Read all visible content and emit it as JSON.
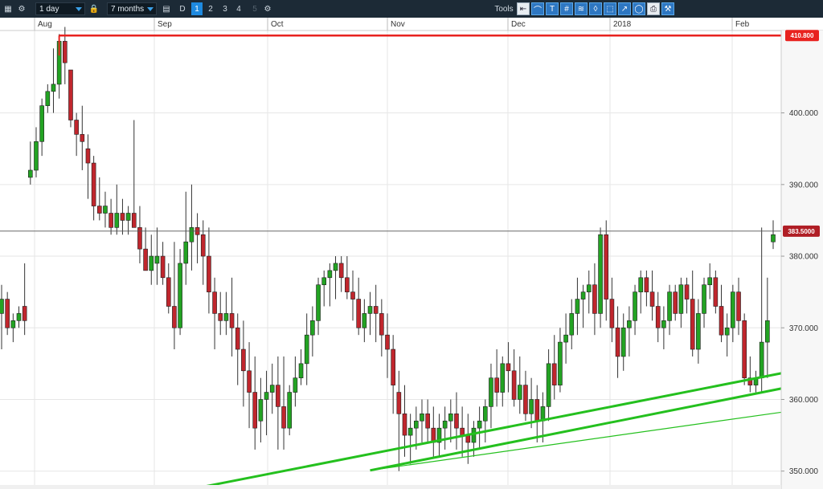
{
  "toolbar": {
    "interval": "1 day",
    "range": "7 months",
    "d_label": "D",
    "layouts": [
      "1",
      "2",
      "3",
      "4",
      "5"
    ],
    "tools_label": "Tools"
  },
  "colors": {
    "up": "#23a323",
    "down": "#c0262d",
    "resistance": "#e8221f",
    "support": "#24c01e",
    "grid": "#e6e6e6"
  },
  "chart_data": {
    "type": "candlestick",
    "y_axis": {
      "ticks": [
        "350.000",
        "360.000",
        "370.000",
        "380.000",
        "390.000",
        "400.000"
      ],
      "ylim": [
        347.5,
        411.5
      ],
      "grid": true
    },
    "x_axis": {
      "months": [
        "Aug",
        "Sep",
        "Oct",
        "Nov",
        "Dec",
        "2018",
        "Feb"
      ]
    },
    "last_price": "383.5000",
    "resistance_level": "410.800",
    "candles": [
      [
        372,
        376,
        367,
        374
      ],
      [
        374,
        375,
        369,
        370
      ],
      [
        370,
        372,
        368,
        371
      ],
      [
        371,
        373,
        370,
        372
      ],
      [
        373,
        379,
        369,
        371
      ],
      [
        391,
        396,
        390,
        392
      ],
      [
        392,
        398,
        391,
        396
      ],
      [
        396,
        402,
        394,
        401
      ],
      [
        401,
        404,
        400,
        403
      ],
      [
        403,
        409,
        400,
        404
      ],
      [
        404,
        411,
        402,
        410
      ],
      [
        410,
        412,
        404,
        407
      ],
      [
        406,
        406,
        398,
        399
      ],
      [
        399,
        400,
        394,
        397
      ],
      [
        397,
        401,
        392,
        396
      ],
      [
        395,
        397,
        388,
        393
      ],
      [
        393,
        394,
        385,
        387
      ],
      [
        387,
        391,
        385,
        386
      ],
      [
        386,
        389,
        384,
        387
      ],
      [
        386,
        388,
        383,
        384
      ],
      [
        384,
        390,
        383,
        386
      ],
      [
        386,
        388,
        383,
        385
      ],
      [
        385,
        387,
        383,
        386
      ],
      [
        386,
        399,
        385,
        384
      ],
      [
        384,
        387,
        379,
        381
      ],
      [
        381,
        384,
        378,
        378
      ],
      [
        378,
        383,
        376,
        380
      ],
      [
        379,
        384,
        376,
        380
      ],
      [
        380,
        382,
        376,
        377
      ],
      [
        377,
        379,
        372,
        373
      ],
      [
        373,
        382,
        367,
        370
      ],
      [
        370,
        381,
        369,
        379
      ],
      [
        379,
        389,
        376,
        382
      ],
      [
        382,
        390,
        378,
        384
      ],
      [
        384,
        386,
        379,
        383
      ],
      [
        383,
        385,
        376,
        380
      ],
      [
        380,
        384,
        372,
        375
      ],
      [
        375,
        377,
        367,
        372
      ],
      [
        372,
        375,
        369,
        371
      ],
      [
        371,
        375,
        369,
        372
      ],
      [
        372,
        377,
        366,
        370
      ],
      [
        370,
        372,
        362,
        367
      ],
      [
        367,
        371,
        359,
        364
      ],
      [
        364,
        368,
        356,
        361
      ],
      [
        361,
        366,
        353,
        356
      ],
      [
        357,
        363,
        354,
        360
      ],
      [
        360,
        364,
        355,
        361
      ],
      [
        361,
        365,
        358,
        362
      ],
      [
        362,
        366,
        353,
        359
      ],
      [
        359,
        366,
        353,
        356
      ],
      [
        356,
        362,
        355,
        361
      ],
      [
        361,
        366,
        359,
        363
      ],
      [
        363,
        367,
        362,
        365
      ],
      [
        365,
        372,
        362,
        369
      ],
      [
        369,
        373,
        366,
        371
      ],
      [
        371,
        377,
        369,
        376
      ],
      [
        376,
        378,
        373,
        377
      ],
      [
        377,
        379,
        373,
        378
      ],
      [
        378,
        380,
        374,
        379
      ],
      [
        379,
        380,
        375,
        377
      ],
      [
        377,
        380,
        374,
        375
      ],
      [
        375,
        378,
        371,
        374
      ],
      [
        374,
        377,
        369,
        370
      ],
      [
        370,
        374,
        368,
        372
      ],
      [
        372,
        375,
        369,
        373
      ],
      [
        373,
        376,
        368,
        372
      ],
      [
        372,
        374,
        366,
        369
      ],
      [
        369,
        372,
        363,
        367
      ],
      [
        367,
        369,
        358,
        362
      ],
      [
        361,
        364,
        350,
        358
      ],
      [
        358,
        362,
        352,
        355
      ],
      [
        355,
        358,
        351,
        356
      ],
      [
        356,
        359,
        353,
        357
      ],
      [
        357,
        360,
        354,
        358
      ],
      [
        358,
        360,
        354,
        356
      ],
      [
        356,
        359,
        352,
        354
      ],
      [
        354,
        358,
        352,
        356
      ],
      [
        356,
        359,
        353,
        357
      ],
      [
        357,
        360,
        354,
        358
      ],
      [
        358,
        361,
        353,
        356
      ],
      [
        356,
        359,
        352,
        355
      ],
      [
        355,
        358,
        351,
        354
      ],
      [
        354,
        357,
        352,
        356
      ],
      [
        356,
        359,
        353,
        357
      ],
      [
        357,
        360,
        354,
        359
      ],
      [
        359,
        365,
        356,
        363
      ],
      [
        363,
        367,
        359,
        361
      ],
      [
        361,
        366,
        359,
        365
      ],
      [
        365,
        368,
        361,
        364
      ],
      [
        364,
        367,
        359,
        360
      ],
      [
        360,
        366,
        358,
        362
      ],
      [
        362,
        364,
        357,
        358
      ],
      [
        358,
        363,
        356,
        360
      ],
      [
        360,
        362,
        354,
        357
      ],
      [
        357,
        361,
        354,
        359
      ],
      [
        359,
        367,
        357,
        365
      ],
      [
        365,
        369,
        360,
        362
      ],
      [
        362,
        370,
        361,
        368
      ],
      [
        368,
        372,
        365,
        369
      ],
      [
        369,
        374,
        367,
        372
      ],
      [
        372,
        377,
        369,
        374
      ],
      [
        374,
        376,
        370,
        375
      ],
      [
        375,
        378,
        372,
        376
      ],
      [
        376,
        379,
        369,
        372
      ],
      [
        372,
        384,
        370,
        383
      ],
      [
        383,
        385,
        371,
        374
      ],
      [
        374,
        377,
        368,
        370
      ],
      [
        370,
        373,
        363,
        366
      ],
      [
        366,
        372,
        364,
        370
      ],
      [
        370,
        373,
        366,
        371
      ],
      [
        371,
        376,
        369,
        375
      ],
      [
        375,
        378,
        372,
        377
      ],
      [
        377,
        378,
        373,
        375
      ],
      [
        375,
        378,
        371,
        373
      ],
      [
        373,
        375,
        368,
        370
      ],
      [
        370,
        373,
        367,
        371
      ],
      [
        371,
        376,
        369,
        375
      ],
      [
        375,
        376,
        371,
        372
      ],
      [
        372,
        377,
        370,
        376
      ],
      [
        376,
        377,
        372,
        374
      ],
      [
        374,
        378,
        366,
        367
      ],
      [
        367,
        374,
        365,
        372
      ],
      [
        372,
        377,
        370,
        376
      ],
      [
        376,
        379,
        374,
        377
      ],
      [
        377,
        378,
        372,
        373
      ],
      [
        373,
        376,
        368,
        369
      ],
      [
        369,
        372,
        366,
        370
      ],
      [
        370,
        376,
        368,
        375
      ],
      [
        375,
        377,
        369,
        371
      ],
      [
        371,
        372,
        362,
        363
      ],
      [
        363,
        366,
        361,
        362
      ],
      [
        362,
        364,
        361,
        363
      ],
      [
        363,
        384,
        361,
        368
      ],
      [
        368,
        377,
        363,
        371
      ],
      [
        382,
        385,
        381,
        383
      ]
    ],
    "trendlines": [
      {
        "name": "support-main",
        "from": [
          21,
          345.6
        ],
        "to": [
          130,
          362.8
        ],
        "thick": true
      },
      {
        "name": "support-minor",
        "from": [
          64,
          350.1
        ],
        "to": [
          130,
          357.6
        ],
        "thick": false
      },
      {
        "name": "support-dec",
        "from": [
          64,
          350.1
        ],
        "to": [
          84,
          353.3
        ],
        "thick": true
      }
    ]
  }
}
